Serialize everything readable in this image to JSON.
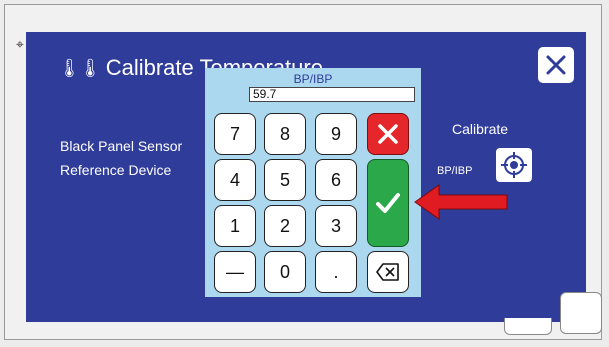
{
  "dialog": {
    "title": "Calibrate Temperature",
    "title_icon": "thermometer-icon",
    "close_icon": "close-icon",
    "rows": [
      {
        "label": "Black Panel Sensor"
      },
      {
        "label": "Reference Device"
      }
    ],
    "calibrate_header": "Calibrate",
    "calibrate_sub_label": "BP/IBP",
    "calibrate_icon": "crosshair-target-icon"
  },
  "keypad": {
    "title": "BP/IBP",
    "display_value": "59.7",
    "keys": {
      "k7": "7",
      "k8": "8",
      "k9": "9",
      "k4": "4",
      "k5": "5",
      "k6": "6",
      "k1": "1",
      "k2": "2",
      "k3": "3",
      "minus": "—",
      "k0": "0",
      "dot": "."
    },
    "cancel_icon": "x-icon",
    "enter_icon": "checkmark-icon",
    "backspace_icon": "backspace-icon"
  },
  "colors": {
    "screen_bg": "#2f3c9a",
    "keypad_bg": "#abd7ef",
    "cancel": "#e5262a",
    "enter": "#2aa84a",
    "annotation_arrow": "#e11b22"
  }
}
